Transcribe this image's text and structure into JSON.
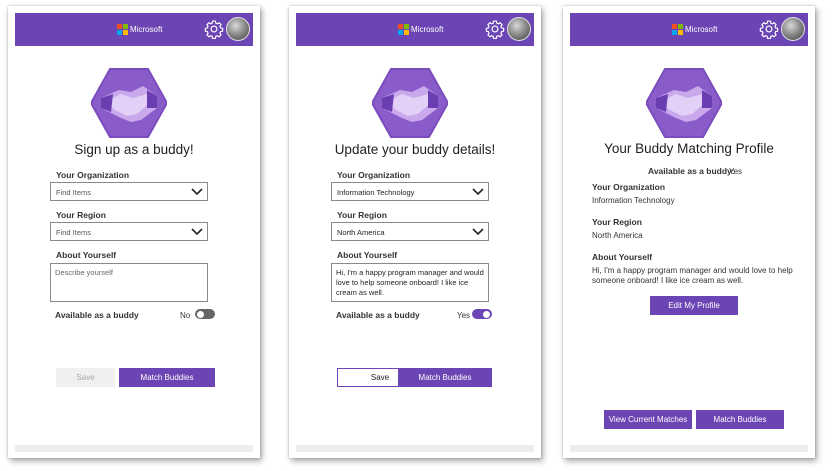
{
  "colors": {
    "brand": "#6b45b3",
    "header_text": "#ffffff"
  },
  "header": {
    "brand": "Microsoft",
    "settings_icon": "gear-icon",
    "avatar_icon": "user-avatar"
  },
  "panel1": {
    "title": "Sign up as a buddy!",
    "org_label": "Your Organization",
    "org_placeholder": "Find Items",
    "region_label": "Your Region",
    "region_placeholder": "Find Items",
    "about_label": "About Yourself",
    "about_placeholder": "Describe yourself",
    "available_label": "Available as a buddy",
    "available_value": "No",
    "save_label": "Save",
    "match_label": "Match Buddies"
  },
  "panel2": {
    "title": "Update your buddy details!",
    "org_label": "Your Organization",
    "org_value": "Information Technology",
    "region_label": "Your Region",
    "region_value": "North America",
    "about_label": "About Yourself",
    "about_value": "Hi, I'm a happy program manager and would love to help someone onboard! I like ice cream as well.",
    "available_label": "Available as a buddy",
    "available_value": "Yes",
    "save_label": "Save",
    "match_label": "Match Buddies"
  },
  "panel3": {
    "title": "Your Buddy Matching Profile",
    "available_label": "Available as a buddy:",
    "available_value": "Yes",
    "org_label": "Your Organization",
    "org_value": "Information Technology",
    "region_label": "Your Region",
    "region_value": "North America",
    "about_label": "About Yourself",
    "about_value": "Hi, I'm a happy program manager and would love to help someone onboard! I like ice cream as well.",
    "edit_label": "Edit My Profile",
    "view_label": "View Current Matches",
    "match_label": "Match Buddies"
  }
}
